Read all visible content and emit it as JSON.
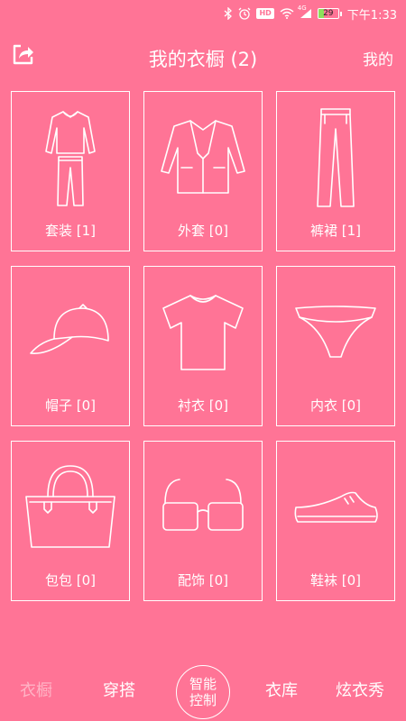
{
  "status_bar": {
    "time": "下午1:33",
    "battery_level": "29",
    "network_badge": "HD",
    "signal_label": "4G",
    "icons": [
      "bluetooth-icon",
      "alarm-icon",
      "hd-icon",
      "wifi-icon",
      "signal-icon",
      "battery-icon"
    ]
  },
  "header": {
    "title": "我的衣橱 (2)",
    "right_link": "我的",
    "share_icon": "share-icon"
  },
  "categories": [
    {
      "label": "套装 [1]",
      "icon": "suit-icon"
    },
    {
      "label": "外套 [0]",
      "icon": "coat-icon"
    },
    {
      "label": "裤裙 [1]",
      "icon": "pants-icon"
    },
    {
      "label": "帽子 [0]",
      "icon": "cap-icon"
    },
    {
      "label": "衬衣 [0]",
      "icon": "tshirt-icon"
    },
    {
      "label": "内衣 [0]",
      "icon": "underwear-icon"
    },
    {
      "label": "包包 [0]",
      "icon": "handbag-icon"
    },
    {
      "label": "配饰 [0]",
      "icon": "glasses-icon"
    },
    {
      "label": "鞋袜 [0]",
      "icon": "shoe-icon"
    }
  ],
  "bottom_nav": {
    "wardrobe": "衣橱",
    "outfit": "穿搭",
    "smart_line1": "智能",
    "smart_line2": "控制",
    "closet": "衣库",
    "show": "炫衣秀"
  },
  "colors": {
    "background": "#FF7496",
    "active_tab": "#FFB3C5"
  }
}
